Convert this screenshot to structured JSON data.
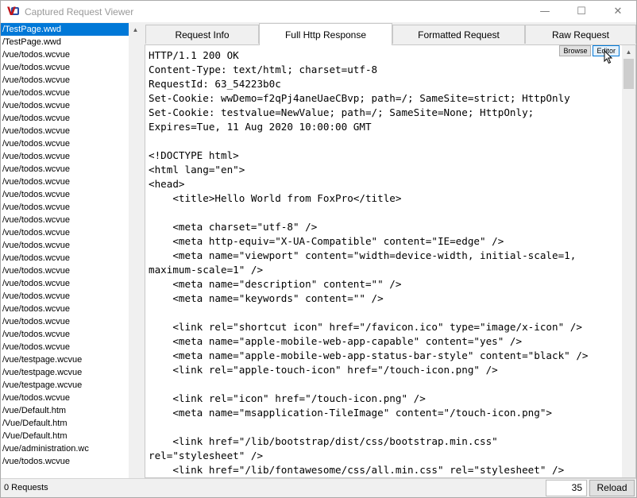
{
  "window": {
    "title": "Captured Request Viewer",
    "icon": "west-wind-logo-icon",
    "buttons": [
      "minimize-icon",
      "maximize-icon",
      "close-icon"
    ]
  },
  "requests": [
    "/TestPage.wwd",
    "/TestPage.wwd",
    "/vue/todos.wcvue",
    "/vue/todos.wcvue",
    "/vue/todos.wcvue",
    "/vue/todos.wcvue",
    "/vue/todos.wcvue",
    "/vue/todos.wcvue",
    "/vue/todos.wcvue",
    "/vue/todos.wcvue",
    "/vue/todos.wcvue",
    "/vue/todos.wcvue",
    "/vue/todos.wcvue",
    "/vue/todos.wcvue",
    "/vue/todos.wcvue",
    "/vue/todos.wcvue",
    "/vue/todos.wcvue",
    "/vue/todos.wcvue",
    "/vue/todos.wcvue",
    "/vue/todos.wcvue",
    "/vue/todos.wcvue",
    "/vue/todos.wcvue",
    "/vue/todos.wcvue",
    "/vue/todos.wcvue",
    "/vue/todos.wcvue",
    "/vue/todos.wcvue",
    "/vue/testpage.wcvue",
    "/vue/testpage.wcvue",
    "/vue/testpage.wcvue",
    "/vue/todos.wcvue",
    "/vue/Default.htm",
    "/Vue/Default.htm",
    "/Vue/Default.htm",
    "/vue/administration.wc",
    "/vue/todos.wcvue"
  ],
  "selected_index": 0,
  "tabs": [
    {
      "label": "Request Info"
    },
    {
      "label": "Full Http Response"
    },
    {
      "label": "Formatted Request"
    },
    {
      "label": "Raw Request"
    }
  ],
  "active_tab": "Full Http Response",
  "view_buttons": {
    "browse": "Browse",
    "editor": "Editor"
  },
  "response_lines": [
    "HTTP/1.1 200 OK",
    "Content-Type: text/html; charset=utf-8",
    "RequestId: 63_54223b0c",
    "Set-Cookie: wwDemo=f2qPj4aneUaeCBvp; path=/; SameSite=strict; HttpOnly",
    "Set-Cookie: testvalue=NewValue; path=/; SameSite=None; HttpOnly;",
    "Expires=Tue, 11 Aug 2020 10:00:00 GMT",
    "",
    "<!DOCTYPE html>",
    "<html lang=\"en\">",
    "<head>",
    "    <title>Hello World from FoxPro</title>",
    "",
    "    <meta charset=\"utf-8\" />",
    "    <meta http-equiv=\"X-UA-Compatible\" content=\"IE=edge\" />",
    "    <meta name=\"viewport\" content=\"width=device-width, initial-scale=1,",
    "maximum-scale=1\" />",
    "    <meta name=\"description\" content=\"\" />",
    "    <meta name=\"keywords\" content=\"\" />",
    "",
    "    <link rel=\"shortcut icon\" href=\"/favicon.ico\" type=\"image/x-icon\" />",
    "    <meta name=\"apple-mobile-web-app-capable\" content=\"yes\" />",
    "    <meta name=\"apple-mobile-web-app-status-bar-style\" content=\"black\" />",
    "    <link rel=\"apple-touch-icon\" href=\"/touch-icon.png\" />",
    "",
    "    <link rel=\"icon\" href=\"/touch-icon.png\" />",
    "    <meta name=\"msapplication-TileImage\" content=\"/touch-icon.png\">",
    "",
    "    <link href=\"/lib/bootstrap/dist/css/bootstrap.min.css\"",
    "rel=\"stylesheet\" />",
    "    <link href=\"/lib/fontawesome/css/all.min.css\" rel=\"stylesheet\" />"
  ],
  "status": {
    "requests_label": "0 Requests",
    "count_value": "35",
    "reload_label": "Reload"
  }
}
